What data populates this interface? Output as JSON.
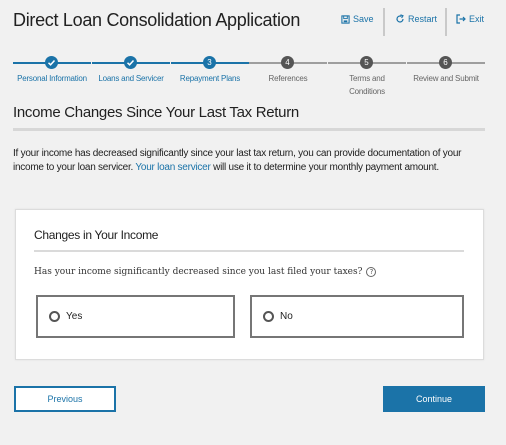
{
  "header": {
    "title": "Direct Loan Consolidation Application",
    "save_label": "Save",
    "restart_label": "Restart",
    "exit_label": "Exit"
  },
  "steps": [
    {
      "number": "1",
      "label": "Personal Information",
      "state": "done"
    },
    {
      "number": "2",
      "label": "Loans and Servicer",
      "state": "done"
    },
    {
      "number": "3",
      "label": "Repayment Plans",
      "state": "current"
    },
    {
      "number": "4",
      "label": "References",
      "state": "pending"
    },
    {
      "number": "5",
      "label": "Terms and Conditions",
      "state": "pending"
    },
    {
      "number": "6",
      "label": "Review and Submit",
      "state": "pending"
    }
  ],
  "section": {
    "title": "Income Changes Since Your Last Tax Return",
    "intro_before": "If your income has decreased significantly since your last tax return, you can provide documentation of your income to your loan servicer. ",
    "intro_link": "Your loan servicer",
    "intro_after": " will use it to determine your monthly payment amount."
  },
  "card": {
    "title": "Changes in Your Income",
    "question": "Has your income significantly decreased since you last filed your taxes?",
    "options": [
      "Yes",
      "No"
    ]
  },
  "buttons": {
    "previous": "Previous",
    "continue": "Continue"
  },
  "colors": {
    "accent": "#1b73a8",
    "background": "#f1f1f1"
  }
}
